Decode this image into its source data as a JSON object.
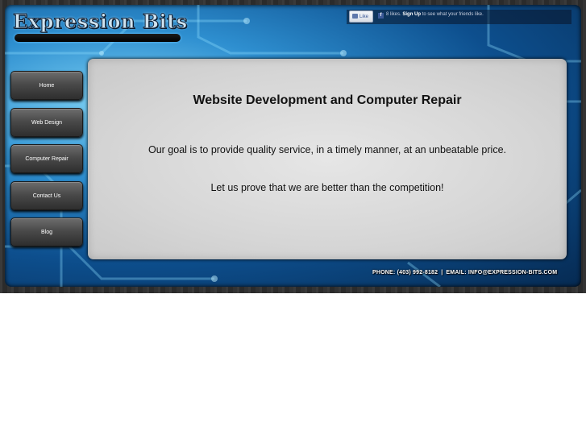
{
  "header": {
    "logo_text": "Expression Bits"
  },
  "facebook": {
    "like_label": "Like",
    "count_text": "8 likes.",
    "signup_label": "Sign Up",
    "signup_suffix": " to see what your friends like."
  },
  "nav": {
    "items": [
      {
        "label": "Home"
      },
      {
        "label": "Web Design"
      },
      {
        "label": "Computer Repair"
      },
      {
        "label": "Contact Us"
      },
      {
        "label": "Blog"
      }
    ]
  },
  "content": {
    "title": "Website Development and Computer Repair",
    "line1": "Our goal is to provide quality service, in a timely manner, at an unbeatable price.",
    "line2": "Let us prove that we are better than the competition!"
  },
  "footer": {
    "phone": "PHONE:  (403) 992-8182",
    "separator": "|",
    "email": "EMAIL:  INFO@EXPRESSION-BITS.COM"
  },
  "colors": {
    "accent_blue": "#2e8fd0",
    "dark_blue": "#062a52",
    "panel_gray": "#d6d6d6",
    "nav_gray": "#4a4a4a"
  }
}
